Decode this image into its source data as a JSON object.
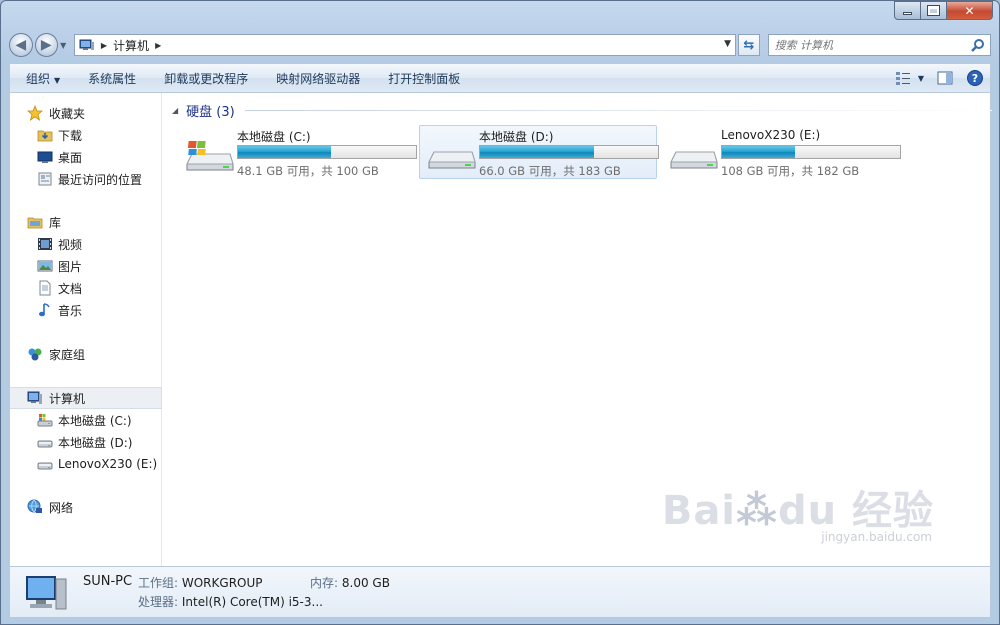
{
  "window": {
    "caption_icons": [
      "minimize-icon",
      "maximize-icon",
      "close-icon"
    ]
  },
  "address": {
    "crumbs": [
      "计算机"
    ],
    "search_placeholder": "搜索 计算机"
  },
  "toolbar": {
    "organize": "组织",
    "system_properties": "系统属性",
    "uninstall": "卸载或更改程序",
    "map_drive": "映射网络驱动器",
    "control_panel": "打开控制面板"
  },
  "nav": {
    "favorites": {
      "label": "收藏夹",
      "items": [
        {
          "label": "下载",
          "icon": "downloads-folder-icon"
        },
        {
          "label": "桌面",
          "icon": "desktop-icon"
        },
        {
          "label": "最近访问的位置",
          "icon": "recent-places-icon"
        }
      ]
    },
    "libraries": {
      "label": "库",
      "items": [
        {
          "label": "视频",
          "icon": "videos-icon"
        },
        {
          "label": "图片",
          "icon": "pictures-icon"
        },
        {
          "label": "文档",
          "icon": "documents-icon"
        },
        {
          "label": "音乐",
          "icon": "music-icon"
        }
      ]
    },
    "homegroup": {
      "label": "家庭组"
    },
    "computer": {
      "label": "计算机",
      "items": [
        {
          "label": "本地磁盘 (C:)",
          "icon": "system-drive-icon"
        },
        {
          "label": "本地磁盘 (D:)",
          "icon": "drive-icon"
        },
        {
          "label": "LenovoX230 (E:)",
          "icon": "drive-icon"
        }
      ]
    },
    "network": {
      "label": "网络"
    }
  },
  "content": {
    "group_title": "硬盘 (3)",
    "drives": [
      {
        "name": "本地磁盘 (C:)",
        "info": "48.1 GB 可用，共 100 GB",
        "used_fraction": 0.52,
        "icon": "system-drive-icon",
        "selected": false
      },
      {
        "name": "本地磁盘 (D:)",
        "info": "66.0 GB 可用，共 183 GB",
        "used_fraction": 0.64,
        "icon": "drive-icon",
        "selected": true
      },
      {
        "name": "LenovoX230 (E:)",
        "info": "108 GB 可用，共 182 GB",
        "used_fraction": 0.41,
        "icon": "drive-icon",
        "selected": false
      }
    ]
  },
  "details": {
    "computer_name": "SUN-PC",
    "workgroup_label": "工作组:",
    "workgroup_value": "WORKGROUP",
    "memory_label": "内存:",
    "memory_value": "8.00 GB",
    "processor_label": "处理器:",
    "processor_value": "Intel(R) Core(TM) i5-3..."
  },
  "watermark": {
    "brand": "Bai du 经验",
    "url": "jingyan.baidu.com"
  },
  "colors": {
    "accent": "#1185b7",
    "group_title": "#1e3287",
    "selection": "#b8d2ee"
  }
}
